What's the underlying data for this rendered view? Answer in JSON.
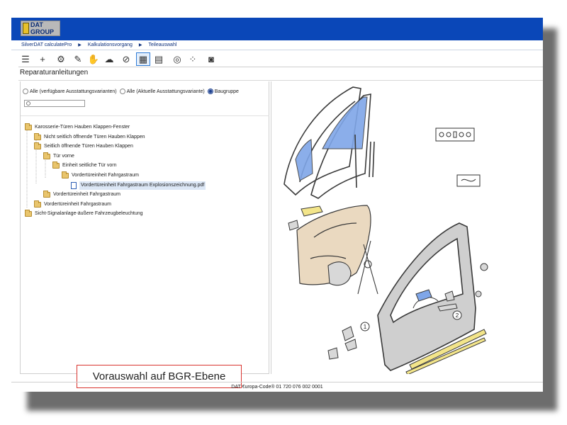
{
  "logo": {
    "line1": "DAT",
    "line2": "GROUP"
  },
  "breadcrumb": [
    "SilverDAT calculatePro",
    "Kalkulationsvorgang",
    "Teileauswahl"
  ],
  "breadcrumb_separator": "▶",
  "toolbar": {
    "buttons": [
      {
        "name": "menu-icon",
        "glyph": "☰"
      },
      {
        "name": "add-magic-icon",
        "glyph": "+"
      },
      {
        "name": "car-parts-icon",
        "glyph": "⚙"
      },
      {
        "name": "spray-icon",
        "glyph": "✎"
      },
      {
        "name": "hand-icon",
        "glyph": "✋"
      },
      {
        "name": "hail-icon",
        "glyph": "☁"
      },
      {
        "name": "cancel-tools-icon",
        "glyph": "⊘"
      },
      {
        "name": "repair-guide-icon",
        "glyph": "▦"
      },
      {
        "name": "money-icon",
        "glyph": "▤"
      },
      {
        "name": "tire-icon",
        "glyph": "◎"
      },
      {
        "name": "settings-grid-icon",
        "glyph": "⁘"
      },
      {
        "name": "camera-icon",
        "glyph": "◙"
      }
    ],
    "active_index": 7
  },
  "panel": {
    "title": "Reparaturanleitungen"
  },
  "filters": {
    "options": [
      {
        "label": "Alle (verfügbare Ausstattungsvarianten)",
        "selected": false
      },
      {
        "label": "Alle (Aktuelle Ausstattungsvariante)",
        "selected": false
      },
      {
        "label": "Baugruppe",
        "selected": true
      }
    ],
    "search_placeholder": ""
  },
  "tree": {
    "nodes": [
      {
        "label": "Karosserie-Türen Hauben Klappen-Fenster",
        "level": 0,
        "type": "folder"
      },
      {
        "label": "Nicht seitlich öffnende Türen Hauben Klappen",
        "level": 1,
        "type": "folder"
      },
      {
        "label": "Seitlich öffnende Türen Hauben Klappen",
        "level": 1,
        "type": "folder"
      },
      {
        "label": "Tür vorne",
        "level": 2,
        "type": "folder"
      },
      {
        "label": "Einheit seitliche Tür vorn",
        "level": 3,
        "type": "folder"
      },
      {
        "label": "Vordertüreinheit Fahrgastraum",
        "level": 4,
        "type": "folder"
      },
      {
        "label": "Vordertüreinheit Fahrgastraum Explosionszeichnung.pdf",
        "level": 5,
        "type": "pdf",
        "selected": true
      },
      {
        "label": "Vordertüreinheit Fahrgastraum",
        "level": 2,
        "type": "folder"
      },
      {
        "label": "Vordertüreinheit Fahrgastraum",
        "level": 1,
        "type": "folder"
      },
      {
        "label": "Sicht-Signalanlage-äußere Fahrzeugbeleuchtung",
        "level": 0,
        "type": "folder"
      }
    ]
  },
  "note": "Vorauswahl auf BGR-Ebene",
  "diagram": {
    "callouts": [
      "1",
      "2"
    ]
  },
  "footer": "DAT €uropa-Code® 01 720 076 002 0001",
  "colors": {
    "topbar": "#0a47b8",
    "highlight_yellow": "#f3e58a",
    "highlight_blue": "#7fa6e8",
    "trim_beige": "#ead9c0",
    "note_border": "#d9342f"
  }
}
